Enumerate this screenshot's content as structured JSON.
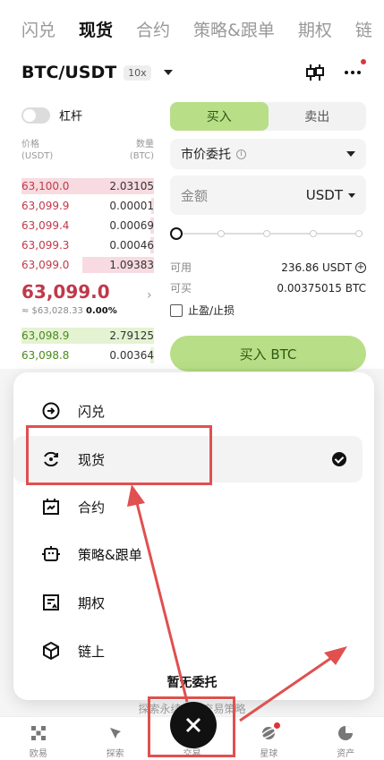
{
  "top_tabs": [
    "闪兑",
    "现货",
    "合约",
    "策略&跟单",
    "期权",
    "链"
  ],
  "active_tab_index": 1,
  "pair": {
    "name": "BTC/USDT",
    "leverage": "10x"
  },
  "leverage_toggle_label": "杠杆",
  "orderbook": {
    "price_header": "价格",
    "price_unit": "(USDT)",
    "qty_header": "数量",
    "qty_unit": "(BTC)",
    "asks": [
      {
        "price": "63,100.0",
        "qty": "2.03105",
        "depth": 1.0
      },
      {
        "price": "63,099.9",
        "qty": "0.00001",
        "depth": 0.02
      },
      {
        "price": "63,099.4",
        "qty": "0.00069",
        "depth": 0.03
      },
      {
        "price": "63,099.3",
        "qty": "0.00046",
        "depth": 0.03
      },
      {
        "price": "63,099.0",
        "qty": "1.09383",
        "depth": 0.54
      }
    ],
    "last_price": "63,099.0",
    "last_price_usd": "≈ $63,028.33",
    "last_change": "0.00%",
    "bids": [
      {
        "price": "63,098.9",
        "qty": "2.79125",
        "depth": 1.0
      },
      {
        "price": "63,098.8",
        "qty": "0.00364",
        "depth": 0.03
      }
    ]
  },
  "form": {
    "buy_label": "买入",
    "sell_label": "卖出",
    "order_type": "市价委托",
    "amount_placeholder": "金额",
    "amount_unit": "USDT",
    "available_label": "可用",
    "available_value": "236.86 USDT",
    "can_buy_label": "可买",
    "can_buy_value": "0.00375015 BTC",
    "tpsl_label": "止盈/止损",
    "submit_label": "买入 BTC",
    "slider_level": 0
  },
  "menu": {
    "items": [
      {
        "label": "闪兑",
        "icon": "swap-circle-icon",
        "selected": false
      },
      {
        "label": "现货",
        "icon": "spot-rotate-icon",
        "selected": true
      },
      {
        "label": "合约",
        "icon": "contract-calendar-icon",
        "selected": false
      },
      {
        "label": "策略&跟单",
        "icon": "bot-icon",
        "selected": false
      },
      {
        "label": "期权",
        "icon": "options-doc-icon",
        "selected": false
      },
      {
        "label": "链上",
        "icon": "cube-icon",
        "selected": false
      }
    ]
  },
  "bottom_peek": {
    "title": "暂无委托",
    "subtitle": "探索永续合约交易策略"
  },
  "bottom_nav": [
    {
      "label": "欧易",
      "icon": "okx-logo-icon"
    },
    {
      "label": "探索",
      "icon": "compass-icon"
    },
    {
      "label": "交易",
      "icon": "close-icon"
    },
    {
      "label": "星球",
      "icon": "planet-icon"
    },
    {
      "label": "资产",
      "icon": "pie-chart-icon"
    }
  ],
  "colors": {
    "buy_green": "#b8de88",
    "ask_red": "#c0394a",
    "bid_green": "#4a8a1c",
    "annotation_red": "#e05050"
  }
}
